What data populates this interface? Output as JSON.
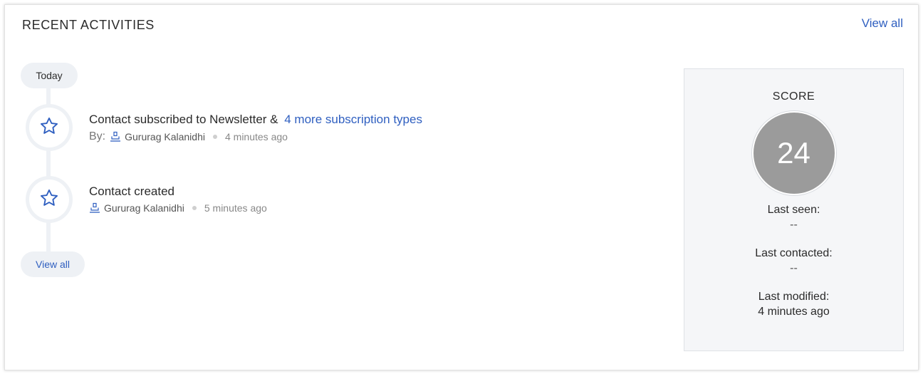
{
  "header": {
    "title": "RECENT ACTIVITIES",
    "view_all": "View all"
  },
  "timeline": {
    "today_label": "Today",
    "view_all_label": "View all",
    "activities": [
      {
        "icon": "star-icon",
        "title": "Contact subscribed to Newsletter &",
        "link": "4 more subscription types",
        "by_label": "By:",
        "user": "Gururag Kalanidhi",
        "time": "4 minutes ago"
      },
      {
        "icon": "star-icon",
        "title": "Contact created",
        "user": "Gururag Kalanidhi",
        "time": "5 minutes ago"
      }
    ]
  },
  "score_panel": {
    "label": "SCORE",
    "score": "24",
    "last_seen_label": "Last seen:",
    "last_seen_value": "--",
    "last_contacted_label": "Last contacted:",
    "last_contacted_value": "--",
    "last_modified_label": "Last modified:",
    "last_modified_value": "4 minutes ago"
  },
  "colors": {
    "accent": "#2f5fc0",
    "score_circle": "#9b9b9b",
    "timeline": "#eef1f5"
  }
}
